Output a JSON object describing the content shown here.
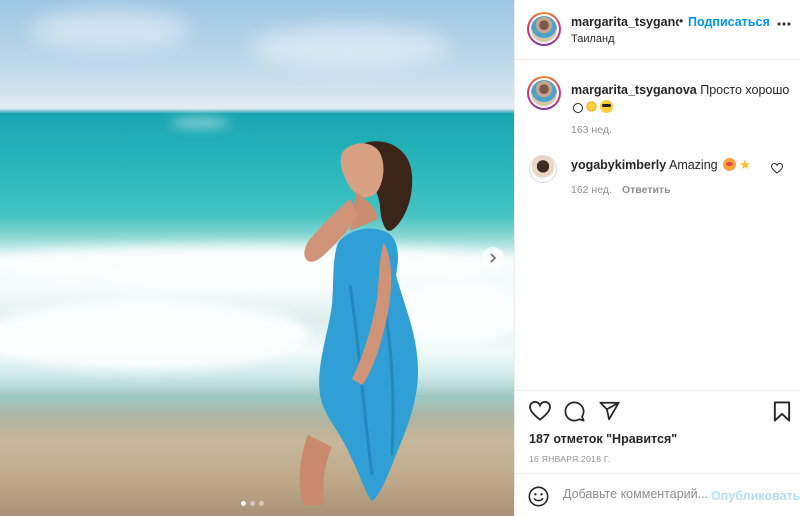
{
  "post": {
    "username": "margarita_tsyganova",
    "follow_label": "Подписаться",
    "separator": "•",
    "location": "Таиланд",
    "more_icon": "more-horizontal-icon"
  },
  "caption": {
    "username": "margarita_tsyganova",
    "text": "Просто хорошо",
    "emojis": [
      "slightly-smiling-face",
      "sun",
      "smiling-face-with-sunglasses"
    ],
    "time": "163 нед."
  },
  "comments": [
    {
      "username": "yogabykimberly",
      "text": "Amazing",
      "emojis": [
        "cat-face",
        "star"
      ],
      "time": "162 нед.",
      "reply_label": "Ответить"
    }
  ],
  "actions": {
    "icons": [
      "heart-icon",
      "comment-icon",
      "share-icon",
      "bookmark-icon"
    ],
    "likes_text": "187 отметок \"Нравится\"",
    "date": "16 ЯНВАРЯ 2018 Г."
  },
  "add_comment": {
    "placeholder": "Добавьте комментарий...",
    "post_label": "Опубликовать"
  },
  "carousel": {
    "slide_count": 3,
    "active_slide": 1
  },
  "colors": {
    "accent": "#0095f6",
    "muted": "#8e8e8e",
    "post_disabled": "#b2dffc",
    "text": "#262626"
  }
}
